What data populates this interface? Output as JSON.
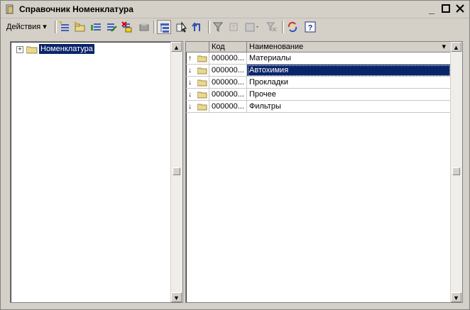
{
  "window": {
    "title": "Справочник Номенклатура",
    "controls": [
      "minimize-icon",
      "maximize-icon",
      "close-icon"
    ]
  },
  "toolbar": {
    "actions_label": "Действия",
    "buttons": [
      "add-icon",
      "add-group-icon",
      "copy-icon",
      "edit-icon",
      "delete-mark-icon",
      "post-icon",
      "hierarchy-icon",
      "move-to-group-icon",
      "up-level-icon",
      "filter-icon",
      "filter-by-value-icon",
      "filter-history-icon",
      "clear-filter-icon",
      "refresh-icon",
      "help-icon"
    ]
  },
  "tree": {
    "root_label": "Номенклатура",
    "expander": "+"
  },
  "list": {
    "columns": [
      "Код",
      "Наименование"
    ],
    "sort_indicator": "▾",
    "rows": [
      {
        "marker": "↑",
        "code": "000000...",
        "name": "Материалы"
      },
      {
        "marker": "↓",
        "code": "000000...",
        "name": "Автохимия",
        "selected": true
      },
      {
        "marker": "↓",
        "code": "000000...",
        "name": "Прокладки"
      },
      {
        "marker": "↓",
        "code": "000000...",
        "name": "Прочее"
      },
      {
        "marker": "↓",
        "code": "000000...",
        "name": "Фильтры"
      }
    ]
  },
  "colors": {
    "selection": "#0a246a",
    "window_bg": "#d4d0c8",
    "folder": "#e8d890"
  }
}
